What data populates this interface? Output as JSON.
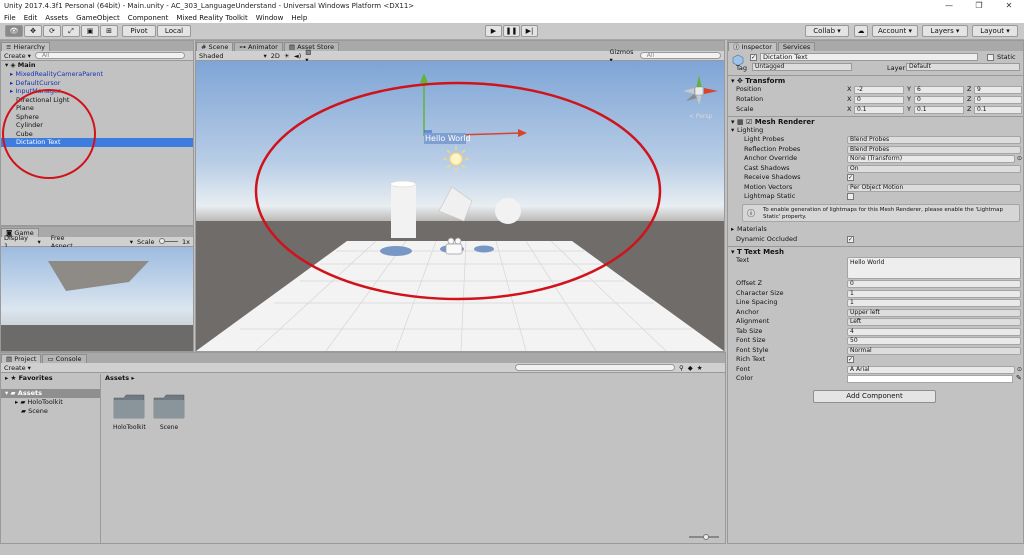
{
  "window": {
    "title": "Unity 2017.4.3f1 Personal (64bit) - Main.unity - AC_303_LanguageUnderstand - Universal Windows Platform <DX11>",
    "controls": [
      "—",
      "❐",
      "✕"
    ]
  },
  "menu": [
    "File",
    "Edit",
    "Assets",
    "GameObject",
    "Component",
    "Mixed Reality Toolkit",
    "Window",
    "Help"
  ],
  "toolbar": {
    "pivot": "Pivot",
    "local": "Local",
    "collab": "Collab ▾",
    "account": "Account ▾",
    "layers": "Layers ▾",
    "layout": "Layout ▾"
  },
  "hierarchy": {
    "tab": "Hierarchy",
    "create": "Create ▾",
    "search": "All",
    "scene": "Main",
    "items": [
      {
        "label": "MixedRealityCameraParent",
        "prefab": true,
        "expand": true
      },
      {
        "label": "DefaultCursor",
        "prefab": true,
        "expand": true
      },
      {
        "label": "InputManager",
        "prefab": true,
        "expand": true
      },
      {
        "label": "Directional Light",
        "prefab": false,
        "expand": false
      },
      {
        "label": "Plane",
        "prefab": false,
        "expand": false
      },
      {
        "label": "Sphere",
        "prefab": false,
        "expand": false
      },
      {
        "label": "Cylinder",
        "prefab": false,
        "expand": false
      },
      {
        "label": "Cube",
        "prefab": false,
        "expand": false
      },
      {
        "label": "Dictation Text",
        "prefab": false,
        "expand": false,
        "selected": true
      }
    ]
  },
  "scene": {
    "tabs": [
      "Scene",
      "Animator",
      "Asset Store"
    ],
    "shaded": "Shaded",
    "mode2d": "2D",
    "gizmos": "Gizmos ▾",
    "search": "All",
    "persp": "< Persp",
    "hello": "Hello World"
  },
  "game": {
    "tab": "Game",
    "display": "Display 1",
    "aspect": "Free Aspect",
    "scale_label": "Scale",
    "scale_value": "1x"
  },
  "project": {
    "tabs": [
      "Project",
      "Console"
    ],
    "create": "Create ▾",
    "favorites": "Favorites",
    "assets": "Assets",
    "folders": [
      "HoloToolkit",
      "Scene"
    ],
    "breadcrumb": "Assets ▸",
    "tiles": [
      "HoloToolkit",
      "Scene"
    ]
  },
  "inspector": {
    "tabs": [
      "Inspector",
      "Services"
    ],
    "object_name": "Dictation Text",
    "static": "Static",
    "tag_label": "Tag",
    "tag": "Untagged",
    "layer_label": "Layer",
    "layer": "Default",
    "transform": {
      "title": "Transform",
      "position": {
        "label": "Position",
        "x": "-2",
        "y": "6",
        "z": "9"
      },
      "rotation": {
        "label": "Rotation",
        "x": "0",
        "y": "0",
        "z": "0"
      },
      "scale": {
        "label": "Scale",
        "x": "0.1",
        "y": "0.1",
        "z": "0.1"
      }
    },
    "mesh_renderer": {
      "title": "Mesh Renderer",
      "lighting": "Lighting",
      "rows": [
        {
          "label": "Light Probes",
          "value": "Blend Probes"
        },
        {
          "label": "Reflection Probes",
          "value": "Blend Probes"
        },
        {
          "label": "Anchor Override",
          "value": "None (Transform)"
        },
        {
          "label": "Cast Shadows",
          "value": "On"
        }
      ],
      "receive_shadows": "Receive Shadows",
      "motion_vectors": {
        "label": "Motion Vectors",
        "value": "Per Object Motion"
      },
      "lightmap_static": "Lightmap Static",
      "info": "To enable generation of lightmaps for this Mesh Renderer, please enable the 'Lightmap Static' property.",
      "materials": "Materials",
      "dynamic_occluded": "Dynamic Occluded"
    },
    "text_mesh": {
      "title": "Text Mesh",
      "text_label": "Text",
      "text": "Hello World",
      "rows": [
        {
          "label": "Offset Z",
          "value": "0"
        },
        {
          "label": "Character Size",
          "value": "1"
        },
        {
          "label": "Line Spacing",
          "value": "1"
        },
        {
          "label": "Anchor",
          "value": "Upper left"
        },
        {
          "label": "Alignment",
          "value": "Left"
        },
        {
          "label": "Tab Size",
          "value": "4"
        },
        {
          "label": "Font Size",
          "value": "50"
        },
        {
          "label": "Font Style",
          "value": "Normal"
        }
      ],
      "rich_text": "Rich Text",
      "font_label": "Font",
      "font": "Arial",
      "color_label": "Color"
    },
    "add_component": "Add Component"
  }
}
